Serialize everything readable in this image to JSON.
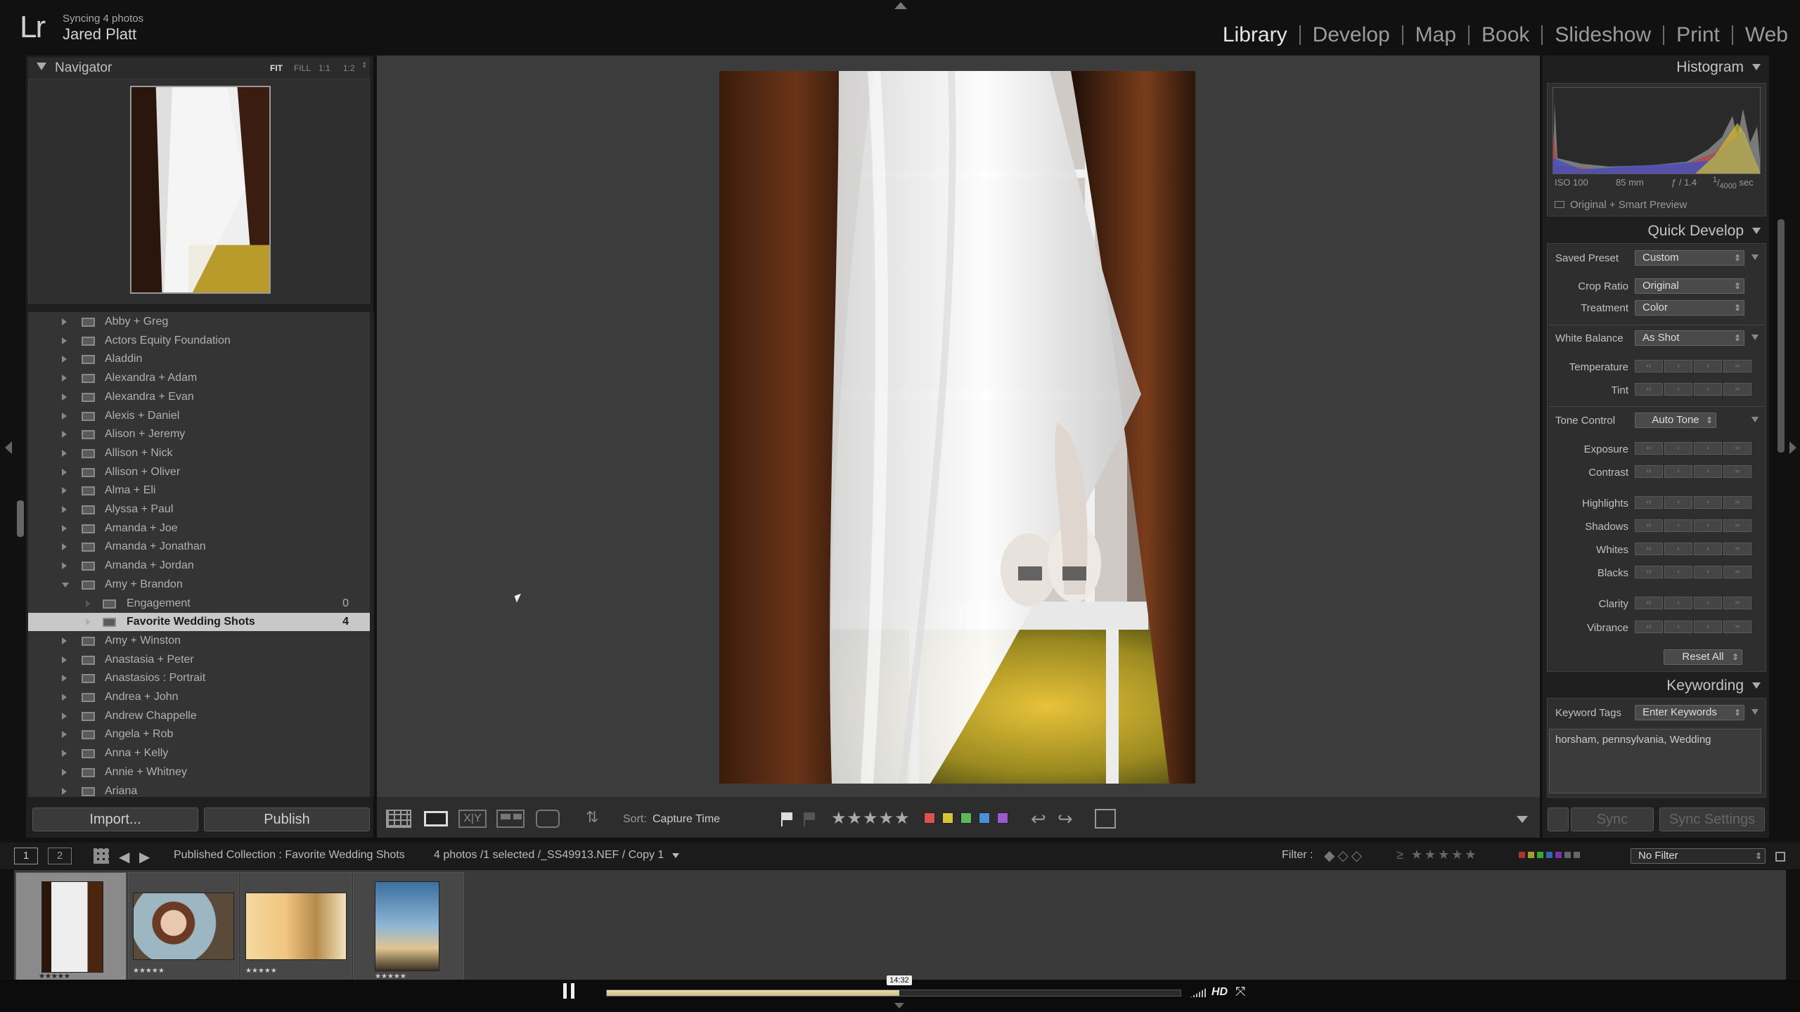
{
  "identity": {
    "logo": "Lr",
    "sync_status": "Syncing 4 photos",
    "user_name": "Jared Platt"
  },
  "modules": [
    {
      "label": "Library",
      "active": true
    },
    {
      "label": "Develop"
    },
    {
      "label": "Map"
    },
    {
      "label": "Book"
    },
    {
      "label": "Slideshow"
    },
    {
      "label": "Print"
    },
    {
      "label": "Web"
    }
  ],
  "navigator": {
    "title": "Navigator",
    "zoom_options": [
      "FIT",
      "FILL",
      "1:1",
      "1:2"
    ]
  },
  "collections": [
    {
      "label": "Abby + Greg"
    },
    {
      "label": "Actors Equity Foundation"
    },
    {
      "label": "Aladdin"
    },
    {
      "label": "Alexandra + Adam"
    },
    {
      "label": "Alexandra + Evan"
    },
    {
      "label": "Alexis + Daniel"
    },
    {
      "label": "Alison + Jeremy"
    },
    {
      "label": "Allison + Nick"
    },
    {
      "label": "Allison + Oliver"
    },
    {
      "label": "Alma + Eli"
    },
    {
      "label": "Alyssa + Paul"
    },
    {
      "label": "Amanda + Joe"
    },
    {
      "label": "Amanda + Jonathan"
    },
    {
      "label": "Amanda + Jordan"
    },
    {
      "label": "Amy + Brandon",
      "open": true
    },
    {
      "label": "Engagement",
      "count": "0",
      "sub": true
    },
    {
      "label": "Favorite Wedding Shots",
      "count": "4",
      "sub": true,
      "selected": true
    },
    {
      "label": "Amy + Winston"
    },
    {
      "label": "Anastasia + Peter"
    },
    {
      "label": "Anastasios : Portrait"
    },
    {
      "label": "Andrea + John"
    },
    {
      "label": "Andrew Chappelle"
    },
    {
      "label": "Angela + Rob"
    },
    {
      "label": "Anna + Kelly"
    },
    {
      "label": "Annie + Whitney"
    },
    {
      "label": "Ariana"
    }
  ],
  "left_buttons": {
    "import": "Import...",
    "publish": "Publish"
  },
  "toolbar": {
    "sort_label": "Sort:",
    "sort_value": "Capture Time",
    "label_colors": [
      "#d9534f",
      "#d6c436",
      "#5cb85c",
      "#4a90d9",
      "#9b59d0"
    ]
  },
  "histogram": {
    "title": "Histogram",
    "iso": "ISO 100",
    "focal": "85 mm",
    "aperture": "ƒ / 1.4",
    "shutter_num": "1",
    "shutter_den": "4000",
    "shutter_unit": "sec",
    "preview_label": "Original + Smart Preview"
  },
  "quick_develop": {
    "title": "Quick Develop",
    "saved_preset_label": "Saved Preset",
    "saved_preset_value": "Custom",
    "crop_label": "Crop Ratio",
    "crop_value": "Original",
    "treatment_label": "Treatment",
    "treatment_value": "Color",
    "wb_label": "White Balance",
    "wb_value": "As Shot",
    "temperature": "Temperature",
    "tint": "Tint",
    "tone_label": "Tone Control",
    "auto_tone": "Auto Tone",
    "exposure": "Exposure",
    "contrast": "Contrast",
    "highlights": "Highlights",
    "shadows": "Shadows",
    "whites": "Whites",
    "blacks": "Blacks",
    "clarity": "Clarity",
    "vibrance": "Vibrance",
    "reset_all": "Reset All"
  },
  "keywording": {
    "title": "Keywording",
    "tags_label": "Keyword Tags",
    "tags_value": "Enter Keywords",
    "keywords": "horsham, pennsylvania, Wedding"
  },
  "sync": {
    "sync": "Sync",
    "sync_settings": "Sync Settings"
  },
  "filmbar": {
    "screen1": "1",
    "screen2": "2",
    "source": "Published Collection : Favorite Wedding Shots",
    "info": "4 photos /1 selected /_SS49913.NEF / Copy 1",
    "filter_label": "Filter :",
    "filter_value": "No Filter"
  },
  "film_ratings": [
    "★★★★★",
    "★★★★★",
    "★★★★★",
    "★★★★★"
  ],
  "video": {
    "time": "14:32",
    "progress": 0.51,
    "hd": "HD"
  }
}
